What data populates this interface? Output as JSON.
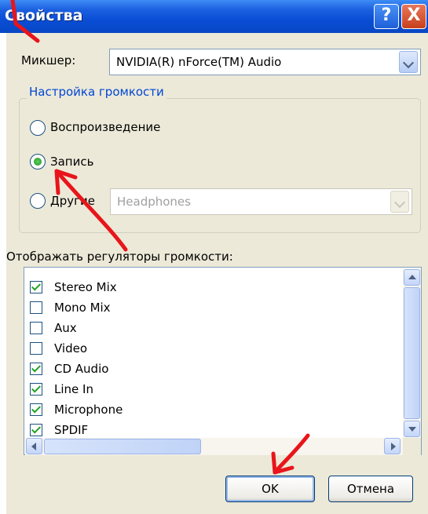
{
  "window": {
    "title": "Свойства",
    "help_label": "?",
    "close_label": "X"
  },
  "mixer": {
    "label": "Микшер:",
    "value": "NVIDIA(R) nForce(TM) Audio"
  },
  "volume_group": {
    "title": "Настройка громкости",
    "options": [
      {
        "label": "Воспроизведение",
        "selected": false
      },
      {
        "label": "Запись",
        "selected": true
      },
      {
        "label": "Другие",
        "selected": false
      }
    ],
    "other_device": "Headphones"
  },
  "controls": {
    "label": "Отображать регуляторы громкости:",
    "items": [
      {
        "label": "Stereo Mix",
        "checked": true
      },
      {
        "label": "Mono Mix",
        "checked": false
      },
      {
        "label": "Aux",
        "checked": false
      },
      {
        "label": "Video",
        "checked": false
      },
      {
        "label": "CD Audio",
        "checked": true
      },
      {
        "label": "Line In",
        "checked": true
      },
      {
        "label": "Microphone",
        "checked": true
      },
      {
        "label": "SPDIF",
        "checked": true
      }
    ]
  },
  "buttons": {
    "ok": "OK",
    "cancel": "Отмена"
  },
  "colors": {
    "titlebar": "#0a4ed6",
    "annotation_arrow": "#e8151b",
    "checkmark": "#21a121",
    "group_title": "#0046d5"
  }
}
